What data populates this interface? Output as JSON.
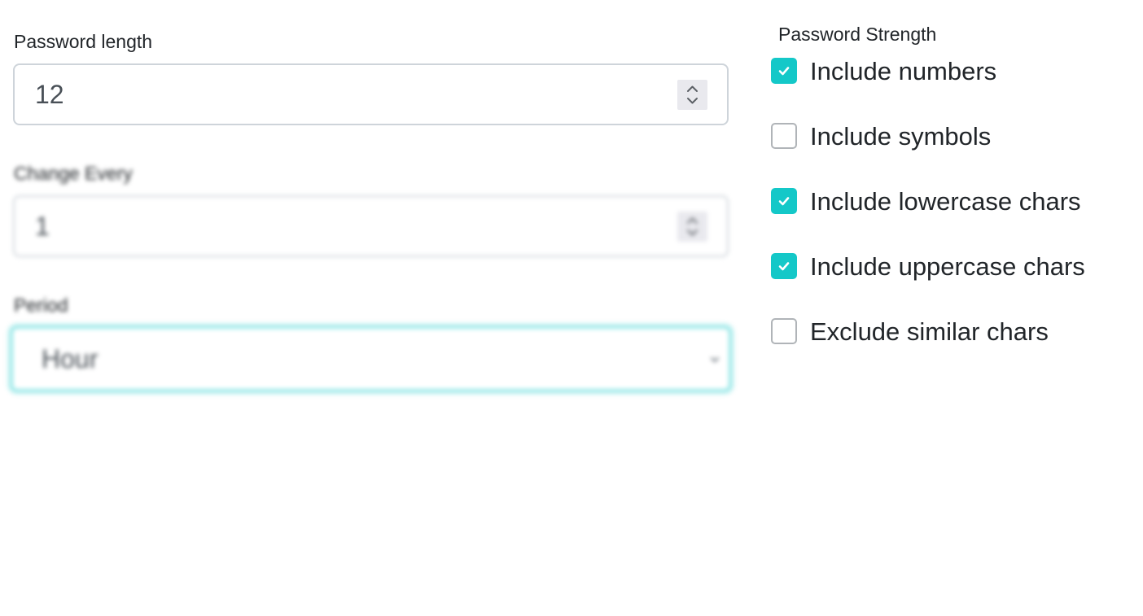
{
  "password_length": {
    "label": "Password length",
    "value": "12"
  },
  "change_every": {
    "label": "Change Every",
    "value": "1"
  },
  "period": {
    "label": "Period",
    "selected": "Hour"
  },
  "strength": {
    "title": "Password Strength",
    "options": [
      {
        "label": "Include numbers",
        "checked": true
      },
      {
        "label": "Include symbols",
        "checked": false
      },
      {
        "label": "Include lowercase chars",
        "checked": true
      },
      {
        "label": "Include uppercase chars",
        "checked": true
      },
      {
        "label": "Exclude similar chars",
        "checked": false
      }
    ]
  },
  "colors": {
    "accent": "#14c8c8",
    "focus_ring": "#8fe6e6",
    "border": "#ced4da"
  },
  "icons": {
    "stepper": "chevron-up-down-icon",
    "select": "chevron-down-icon",
    "checkbox": "checkmark-icon"
  }
}
